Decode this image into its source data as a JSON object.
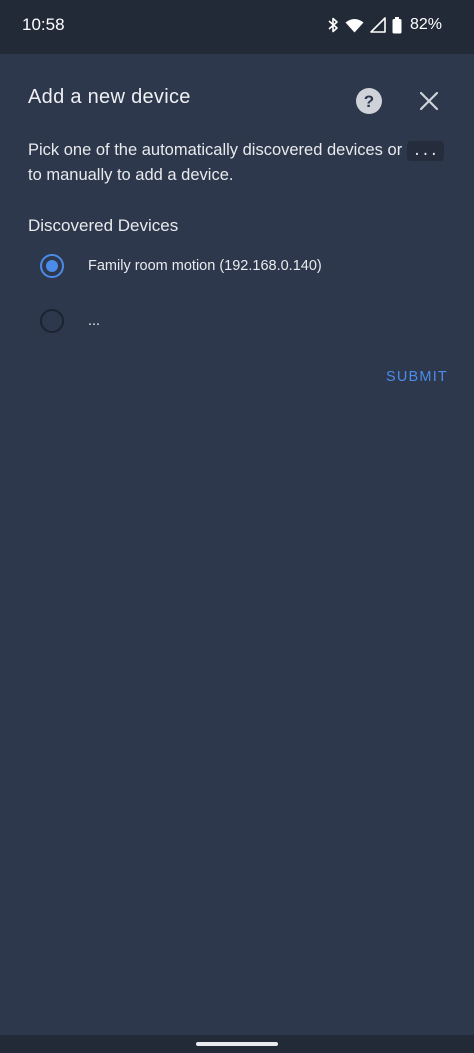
{
  "status_bar": {
    "time": "10:58",
    "battery_percent": "82%",
    "icons": [
      "bluetooth-icon",
      "wifi-icon",
      "signal-icon",
      "battery-icon"
    ]
  },
  "dialog": {
    "title": "Add a new device",
    "help_icon": "question-mark-icon",
    "close_icon": "close-icon",
    "description_prefix": "Pick one of the automatically discovered devices or",
    "description_code": "...",
    "description_suffix": "to manually to add a device.",
    "section_label": "Discovered Devices",
    "options": [
      {
        "label": "Family room motion (192.168.0.140)",
        "selected": true
      },
      {
        "label": "...",
        "selected": false
      }
    ],
    "submit_label": "SUBMIT"
  },
  "colors": {
    "background": "#2e384c",
    "status_bar": "#222a38",
    "accent": "#4b8bea"
  }
}
